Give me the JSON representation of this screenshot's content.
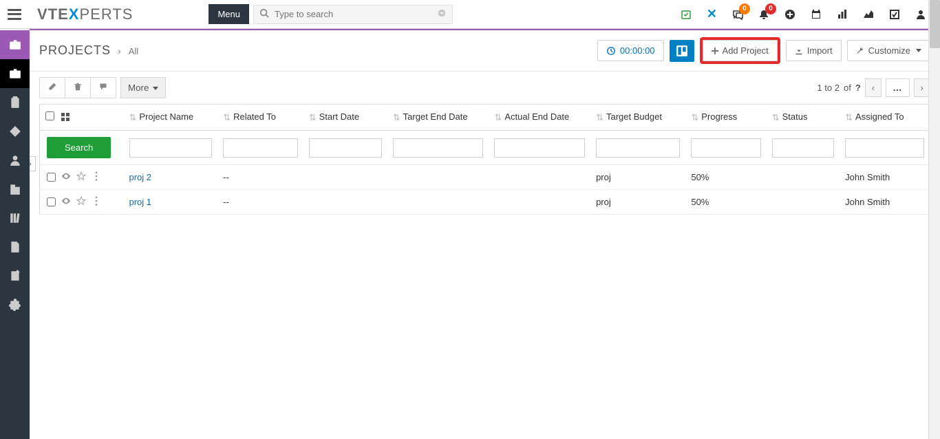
{
  "header": {
    "logo_a": "VTE",
    "logo_x": "X",
    "logo_b": "PERTS",
    "menu_label": "Menu",
    "search_placeholder": "Type to search",
    "chat_badge": "0",
    "bell_badge": "0"
  },
  "page": {
    "title": "PROJECTS",
    "breadcrumb_sub": "All",
    "timer": "00:00:00",
    "add_label": "Add Project",
    "import_label": "Import",
    "customize_label": "Customize",
    "more_label": "More",
    "search_label": "Search",
    "pager_text_a": "1 to 2",
    "pager_text_b": "of",
    "pager_text_c": "?"
  },
  "columns": {
    "c1": "Project Name",
    "c2": "Related To",
    "c3": "Start Date",
    "c4": "Target End Date",
    "c5": "Actual End Date",
    "c6": "Target Budget",
    "c7": "Progress",
    "c8": "Status",
    "c9": "Assigned To"
  },
  "rows": [
    {
      "name": "proj 2",
      "related": "--",
      "start": "",
      "targetend": "",
      "actualend": "",
      "budget": "proj",
      "progress": "50%",
      "status": "",
      "assigned": "John Smith"
    },
    {
      "name": "proj 1",
      "related": "--",
      "start": "",
      "targetend": "",
      "actualend": "",
      "budget": "proj",
      "progress": "50%",
      "status": "",
      "assigned": "John Smith"
    }
  ]
}
